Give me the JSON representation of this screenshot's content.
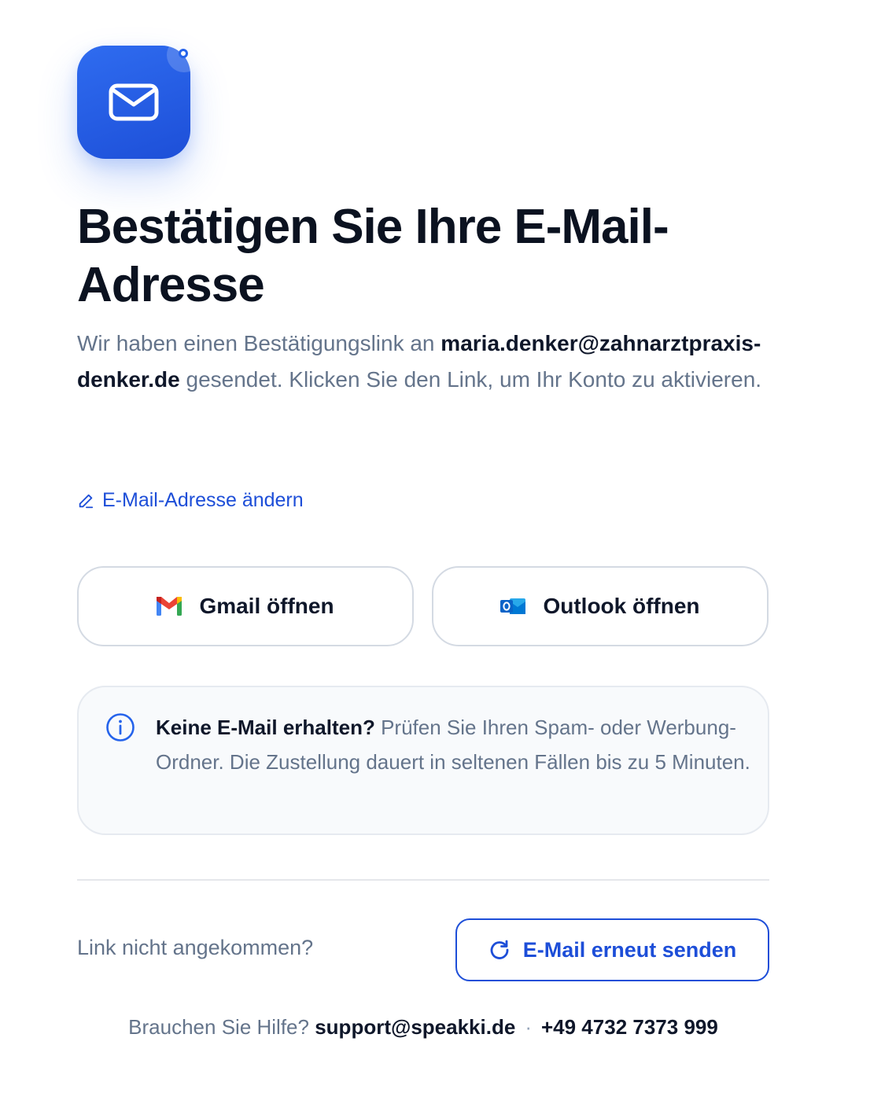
{
  "hero": {
    "icon": "mail-icon",
    "accent_color": "#2563eb"
  },
  "title": "Bestätigen Sie Ihre E-Mail-Adresse",
  "description": {
    "before": "Wir haben einen Bestätigungslink an ",
    "email": "maria.denker@zahnarztpraxis-denker.de",
    "after": " gesendet. Klicken Sie den Link, um Ihr Konto zu aktivieren."
  },
  "change_email": {
    "icon": "pencil-icon",
    "label": "E-Mail-Adresse ändern"
  },
  "open_buttons": {
    "gmail": {
      "icon": "gmail-icon",
      "label": "Gmail öffnen"
    },
    "outlook": {
      "icon": "outlook-icon",
      "label": "Outlook öffnen"
    }
  },
  "info": {
    "icon": "info-icon",
    "heading": "Keine E-Mail erhalten?",
    "text": " Prüfen Sie Ihren Spam- oder Werbung-Ordner. Die Zustellung dauert in seltenen Fällen bis zu 5 Minuten."
  },
  "resend": {
    "question": "Link nicht angekommen?",
    "icon": "refresh-icon",
    "button_label": "E-Mail erneut senden"
  },
  "help": {
    "prefix": "Brauchen Sie Hilfe?",
    "email": "support@speakki.de",
    "separator": "·",
    "phone": "+49 4732 7373 999"
  }
}
